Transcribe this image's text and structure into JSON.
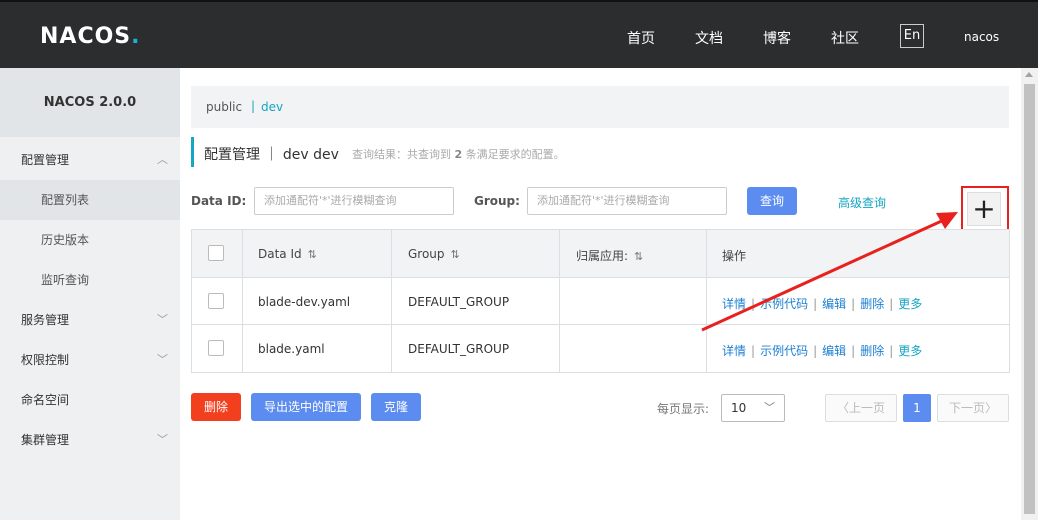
{
  "header": {
    "logo_text": "NACOS",
    "nav": [
      "首页",
      "文档",
      "博客",
      "社区"
    ],
    "lang": "En",
    "user": "nacos"
  },
  "sidebar": {
    "version": "NACOS 2.0.0",
    "items": [
      {
        "label": "配置管理",
        "chevron": "up"
      },
      {
        "label": "配置列表"
      },
      {
        "label": "历史版本"
      },
      {
        "label": "监听查询"
      },
      {
        "label": "服务管理",
        "chevron": "down"
      },
      {
        "label": "权限控制",
        "chevron": "down"
      },
      {
        "label": "命名空间"
      },
      {
        "label": "集群管理",
        "chevron": "down"
      }
    ]
  },
  "breadcrumb": {
    "public": "public",
    "separator": "|",
    "dev": "dev"
  },
  "title": {
    "text": "配置管理 ｜ dev  dev",
    "note_prefix": "查询结果：共查询到",
    "note_count": "2",
    "note_suffix": "条满足要求的配置。"
  },
  "search": {
    "dataid_label": "Data ID:",
    "dataid_placeholder": "添加通配符'*'进行模糊查询",
    "group_label": "Group:",
    "group_placeholder": "添加通配符'*'进行模糊查询",
    "query_button": "查询",
    "advanced": "高级查询",
    "add_button": "+"
  },
  "table": {
    "headers": [
      "Data Id",
      "Group",
      "归属应用:",
      "操作"
    ],
    "sort_icon": "⇅",
    "rows": [
      {
        "data_id": "blade-dev.yaml",
        "group": "DEFAULT_GROUP",
        "app": ""
      },
      {
        "data_id": "blade.yaml",
        "group": "DEFAULT_GROUP",
        "app": ""
      }
    ],
    "ops": [
      "详情",
      "示例代码",
      "编辑",
      "删除",
      "更多"
    ]
  },
  "actions": {
    "delete": "删除",
    "export": "导出选中的配置",
    "clone": "克隆"
  },
  "pagination": {
    "page_size_label": "每页显示:",
    "page_size": "10",
    "prev": "上一页",
    "current": "1",
    "next": "下一页"
  },
  "colors": {
    "accent": "#16a5c2",
    "primary_button": "#5c8cf0",
    "danger_button": "#f2401f",
    "annotation": "#e8201e"
  }
}
